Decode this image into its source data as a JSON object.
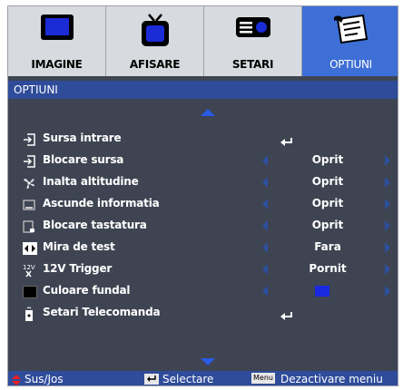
{
  "tabs": [
    {
      "label": "IMAGINE",
      "icon": "monitor-icon"
    },
    {
      "label": "AFISARE",
      "icon": "tv-icon"
    },
    {
      "label": "SETARI",
      "icon": "projector-icon"
    },
    {
      "label": "OPTIUNI",
      "icon": "gear-paper-icon",
      "active": true
    }
  ],
  "header": {
    "title": "OPTIUNI"
  },
  "rows": [
    {
      "label": "Sursa intrare",
      "type": "enter",
      "icon": "input-source-icon"
    },
    {
      "label": "Blocare sursa",
      "value": "Oprit",
      "icon": "input-lock-icon"
    },
    {
      "label": "Inalta altitudine",
      "value": "Oprit",
      "icon": "fan-icon"
    },
    {
      "label": "Ascunde informatia",
      "value": "Oprit",
      "icon": "hide-info-icon"
    },
    {
      "label": "Blocare tastatura",
      "value": "Oprit",
      "icon": "keypad-lock-icon"
    },
    {
      "label": "Mira de test",
      "value": "Fara",
      "icon": "test-pattern-icon"
    },
    {
      "label": "12V Trigger",
      "value": "Pornit",
      "icon": "trigger-12v-icon"
    },
    {
      "label": "Culoare fundal",
      "type": "color",
      "value_color": "#1a28e0",
      "icon": "background-color-icon"
    },
    {
      "label": "Setari Telecomanda",
      "type": "enter",
      "icon": "remote-icon"
    }
  ],
  "footer": {
    "nav_label": "Sus/Jos",
    "select_label": "Selectare",
    "menu_key": "Menu",
    "exit_label": "Dezactivare meniu"
  },
  "colors": {
    "accent": "#3d6fd6",
    "bar": "#2f4c9a",
    "panel": "#3e4452",
    "arrow": "#2a5ae6"
  }
}
